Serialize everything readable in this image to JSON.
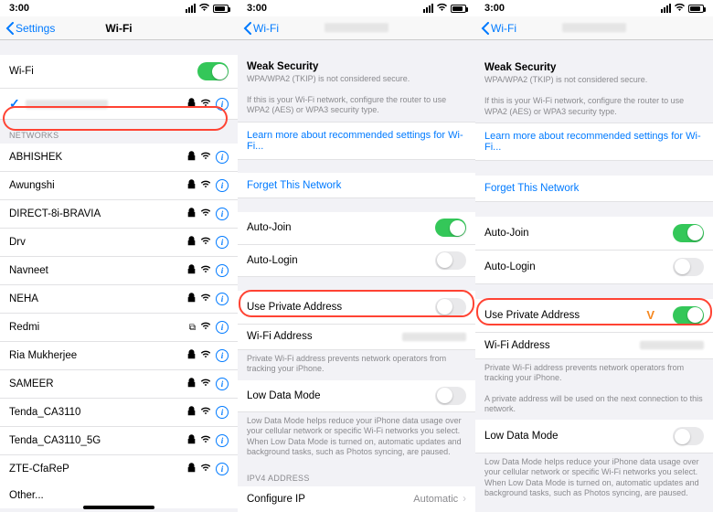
{
  "status": {
    "time": "3:00"
  },
  "panel1": {
    "back": "Settings",
    "title": "Wi-Fi",
    "wifi_row": "Wi-Fi",
    "networks_label": "NETWORKS",
    "networks": [
      {
        "name": "ABHISHEK"
      },
      {
        "name": "Awungshi"
      },
      {
        "name": "DIRECT-8i-BRAVIA"
      },
      {
        "name": "Drv"
      },
      {
        "name": "Navneet"
      },
      {
        "name": "NEHA"
      },
      {
        "name": "Redmi",
        "chain": true
      },
      {
        "name": "Ria Mukherjee"
      },
      {
        "name": "SAMEER"
      },
      {
        "name": "Tenda_CA3110"
      },
      {
        "name": "Tenda_CA3110_5G"
      },
      {
        "name": "ZTE-CfaReP"
      }
    ],
    "other": "Other..."
  },
  "shared": {
    "back": "Wi-Fi",
    "weak_title": "Weak Security",
    "weak_line1": "WPA/WPA2 (TKIP) is not considered secure.",
    "weak_line2": "If this is your Wi-Fi network, configure the router to use WPA2 (AES) or WPA3 security type.",
    "learn_more": "Learn more about recommended settings for Wi-Fi...",
    "forget": "Forget This Network",
    "auto_join": "Auto-Join",
    "auto_login": "Auto-Login",
    "private_addr": "Use Private Address",
    "wifi_addr": "Wi-Fi Address",
    "private_footer": "Private Wi-Fi address prevents network operators from tracking your iPhone.",
    "low_data": "Low Data Mode",
    "low_data_footer": "Low Data Mode helps reduce your iPhone data usage over your cellular network or specific Wi-Fi networks you select. When Low Data Mode is turned on, automatic updates and background tasks, such as Photos syncing, are paused.",
    "ipv4_label": "IPV4 ADDRESS",
    "configure_ip": "Configure IP",
    "configure_ip_val": "Automatic"
  },
  "panel3": {
    "private_extra": "A private address will be used on the next connection to this network."
  }
}
